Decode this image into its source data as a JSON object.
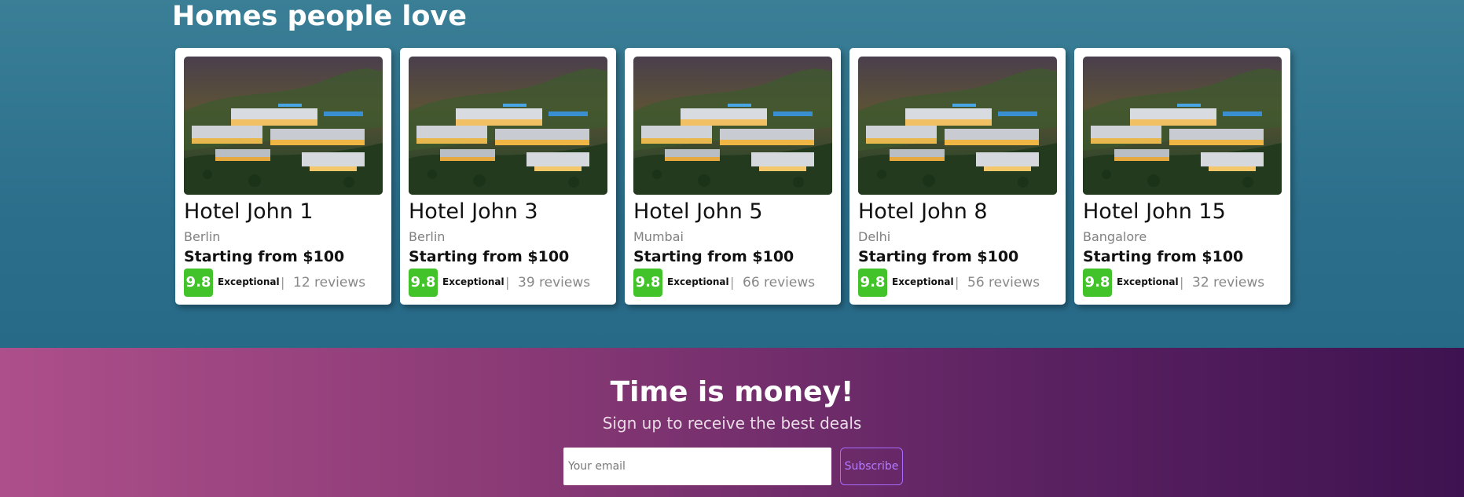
{
  "homes": {
    "title": "Homes people love",
    "cards": [
      {
        "name": "Hotel John 1",
        "city": "Berlin",
        "price": "Starting from $100",
        "score": "9.8",
        "rating_word": "Exceptional",
        "separator": "|",
        "reviews": "12 reviews"
      },
      {
        "name": "Hotel John 3",
        "city": "Berlin",
        "price": "Starting from $100",
        "score": "9.8",
        "rating_word": "Exceptional",
        "separator": "|",
        "reviews": "39 reviews"
      },
      {
        "name": "Hotel John 5",
        "city": "Mumbai",
        "price": "Starting from $100",
        "score": "9.8",
        "rating_word": "Exceptional",
        "separator": "|",
        "reviews": "66 reviews"
      },
      {
        "name": "Hotel John 8",
        "city": "Delhi",
        "price": "Starting from $100",
        "score": "9.8",
        "rating_word": "Exceptional",
        "separator": "|",
        "reviews": "56 reviews"
      },
      {
        "name": "Hotel John 15",
        "city": "Bangalore",
        "price": "Starting from $100",
        "score": "9.8",
        "rating_word": "Exceptional",
        "separator": "|",
        "reviews": "32 reviews"
      }
    ]
  },
  "signup": {
    "title": "Time is money!",
    "subtitle": "Sign up to receive the best deals",
    "email_placeholder": "Your email",
    "email_value": "",
    "subscribe_label": "Subscribe"
  },
  "colors": {
    "score_badge": "#42c32a",
    "subscribe_accent": "#a86bff"
  },
  "icons": {
    "card_photo": "hillside-villa-photo"
  }
}
